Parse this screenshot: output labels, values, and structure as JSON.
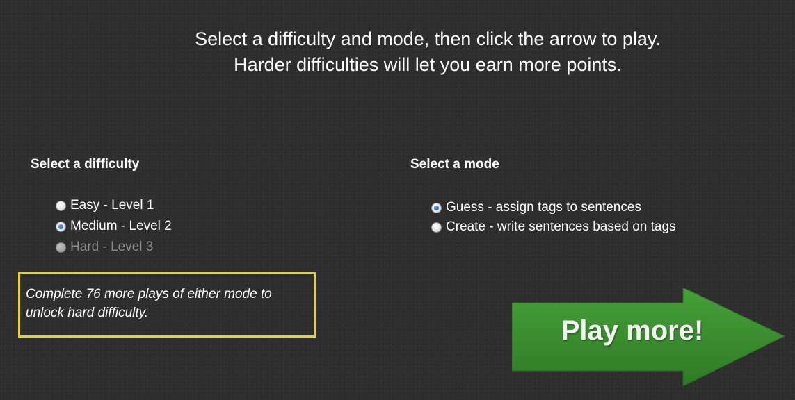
{
  "header": {
    "line1": "Select a difficulty and mode, then click the arrow to play.",
    "line2": "Harder difficulties will let you earn more points."
  },
  "difficulty": {
    "title": "Select a difficulty",
    "options": [
      {
        "label": "Easy - Level 1",
        "checked": false,
        "disabled": false
      },
      {
        "label": "Medium - Level 2",
        "checked": true,
        "disabled": false
      },
      {
        "label": "Hard - Level 3",
        "checked": false,
        "disabled": true
      }
    ]
  },
  "mode": {
    "title": "Select a mode",
    "options": [
      {
        "label": "Guess - assign tags to sentences",
        "checked": true
      },
      {
        "label": "Create - write sentences based on tags",
        "checked": false
      }
    ]
  },
  "notice": {
    "text": "Complete 76 more plays of either mode to unlock hard difficulty."
  },
  "play_button": {
    "label": "Play more!"
  },
  "colors": {
    "background": "#2e2e2e",
    "notice_border": "#e6d51a",
    "arrow_green": "#3a8a2e",
    "radio_checked": "#2a66b8"
  }
}
